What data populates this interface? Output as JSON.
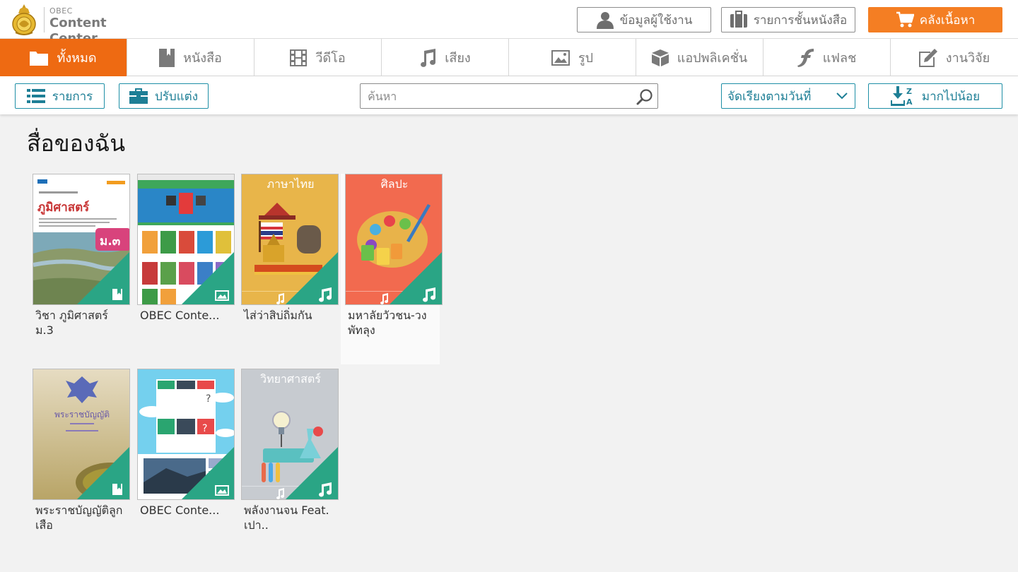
{
  "header": {
    "brand_small": "OBEC",
    "brand_title": "Content Center",
    "buttons": {
      "user_info": "ข้อมูลผู้ใช้งาน",
      "bookshelf": "รายการชั้นหนังสือ",
      "store": "คลังเนื้อหา"
    }
  },
  "tabs": [
    {
      "label": "ทั้งหมด",
      "icon": "folder-icon",
      "active": true
    },
    {
      "label": "หนังสือ",
      "icon": "book-icon"
    },
    {
      "label": "วีดีโอ",
      "icon": "film-icon"
    },
    {
      "label": "เสียง",
      "icon": "music-icon"
    },
    {
      "label": "รูป",
      "icon": "image-icon"
    },
    {
      "label": "แอปพลิเคชั่น",
      "icon": "cube-icon"
    },
    {
      "label": "แฟลช",
      "icon": "flash-icon"
    },
    {
      "label": "งานวิจัย",
      "icon": "edit-icon"
    }
  ],
  "toolbar": {
    "list_label": "รายการ",
    "customize_label": "ปรับแต่ง",
    "search_placeholder": "ค้นหา",
    "sort_value": "จัดเรียงตามวันที่",
    "order_label": "มากไปน้อย"
  },
  "main": {
    "title": "สื่อของฉัน",
    "items": [
      {
        "title": "วิชา ภูมิศาสตร์ ม.3",
        "type": "book",
        "cover_title": "ภูมิศาสตร์",
        "cover_badge": "ม.๓"
      },
      {
        "title": "OBEC Conte...",
        "type": "image"
      },
      {
        "title": "ไส่ว่าสิบ่ถิ่มกัน",
        "type": "audio",
        "cover_title": "ภาษาไทย"
      },
      {
        "title": "มหาลัยวัวชน-วงพัทลุง",
        "type": "audio",
        "cover_title": "ศิลปะ"
      },
      {
        "title": "พระราชบัญญัติลูกเสือ",
        "type": "book",
        "cover_title": "พระราชบัญญัติ"
      },
      {
        "title": "OBEC Conte...",
        "type": "image"
      },
      {
        "title": "พลังงานจน Feat. เปา..",
        "type": "audio",
        "cover_title": "วิทยาศาสตร์"
      }
    ]
  },
  "colors": {
    "accent_orange": "#ee6a12",
    "teal": "#1e8fa6",
    "corner_green": "#2aa585"
  }
}
